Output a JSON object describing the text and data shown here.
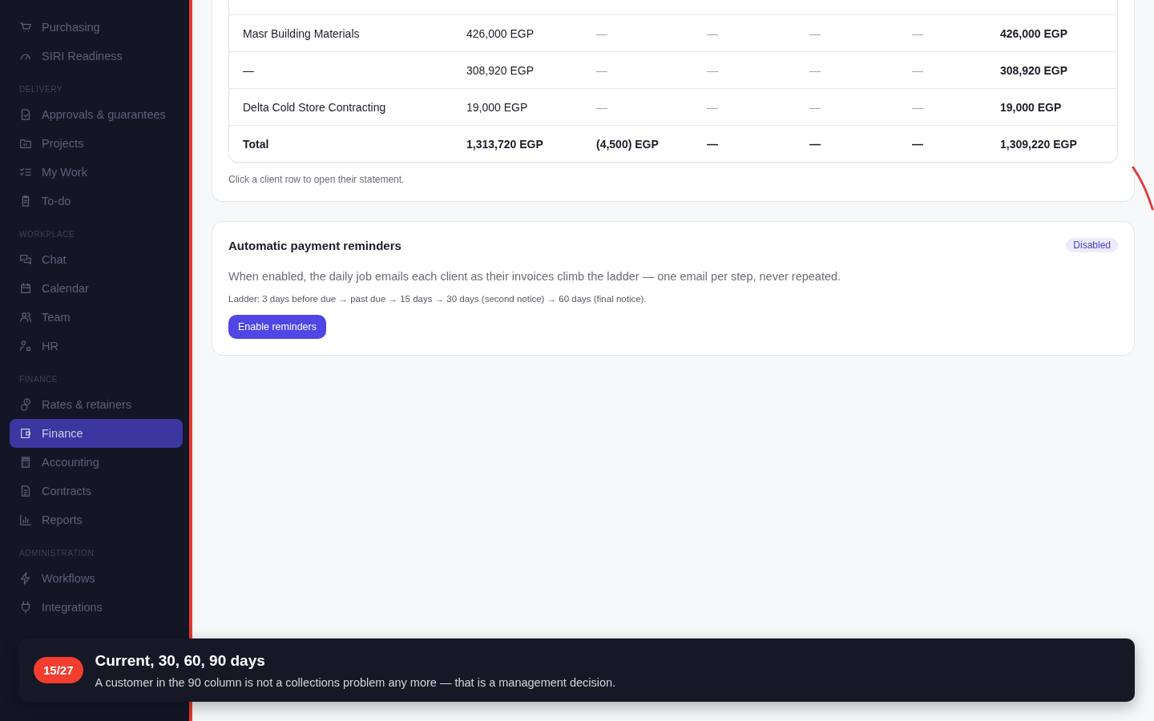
{
  "sidebar": {
    "sections": [
      {
        "items": [
          {
            "label": "Purchasing",
            "selected": false
          },
          {
            "label": "SIRI Readiness",
            "selected": false
          }
        ]
      },
      {
        "label": "DELIVERY",
        "items": [
          {
            "label": "Approvals & guarantees",
            "selected": false
          },
          {
            "label": "Projects",
            "selected": false
          },
          {
            "label": "My Work",
            "selected": false
          },
          {
            "label": "To-do",
            "selected": false
          }
        ]
      },
      {
        "label": "WORKPLACE",
        "items": [
          {
            "label": "Chat",
            "selected": false
          },
          {
            "label": "Calendar",
            "selected": false
          },
          {
            "label": "Team",
            "selected": false
          },
          {
            "label": "HR",
            "selected": false
          }
        ]
      },
      {
        "label": "FINANCE",
        "items": [
          {
            "label": "Rates & retainers",
            "selected": false
          },
          {
            "label": "Finance",
            "selected": true
          },
          {
            "label": "Accounting",
            "selected": false
          },
          {
            "label": "Contracts",
            "selected": false
          },
          {
            "label": "Reports",
            "selected": false
          }
        ]
      },
      {
        "label": "ADMINISTRATION",
        "items": [
          {
            "label": "Workflows",
            "selected": false
          },
          {
            "label": "Integrations",
            "selected": false
          }
        ]
      }
    ]
  },
  "aging_table": {
    "rows": [
      {
        "kind": "client",
        "cells": [
          {
            "text": "Masr Building Materials",
            "muted": false
          },
          {
            "text": "426,000 EGP",
            "muted": false
          },
          {
            "text": "—",
            "muted": true
          },
          {
            "text": "—",
            "muted": true
          },
          {
            "text": "—",
            "muted": true
          },
          {
            "text": "—",
            "muted": true
          },
          {
            "text": "426,000 EGP",
            "muted": false
          }
        ]
      },
      {
        "kind": "client",
        "cells": [
          {
            "text": "—",
            "muted": false
          },
          {
            "text": "308,920 EGP",
            "muted": false
          },
          {
            "text": "—",
            "muted": true
          },
          {
            "text": "—",
            "muted": true
          },
          {
            "text": "—",
            "muted": true
          },
          {
            "text": "—",
            "muted": true
          },
          {
            "text": "308,920 EGP",
            "muted": false
          }
        ]
      },
      {
        "kind": "client",
        "cells": [
          {
            "text": "Delta Cold Store Contracting",
            "muted": false
          },
          {
            "text": "19,000 EGP",
            "muted": false
          },
          {
            "text": "—",
            "muted": true
          },
          {
            "text": "—",
            "muted": true
          },
          {
            "text": "—",
            "muted": true
          },
          {
            "text": "—",
            "muted": true
          },
          {
            "text": "19,000 EGP",
            "muted": false
          }
        ]
      },
      {
        "kind": "total",
        "cells": [
          {
            "text": "Total",
            "muted": false
          },
          {
            "text": "1,313,720 EGP",
            "muted": false
          },
          {
            "text": "(4,500) EGP",
            "muted": false
          },
          {
            "text": "—",
            "muted": false
          },
          {
            "text": "—",
            "muted": false
          },
          {
            "text": "—",
            "muted": false
          },
          {
            "text": "1,309,220 EGP",
            "muted": false
          }
        ]
      }
    ],
    "note": "Click a client row to open their statement."
  },
  "reminders": {
    "title": "Automatic payment reminders",
    "status": "Disabled",
    "description": "When enabled, the daily job emails each client as their invoices climb the ladder — one email per step, never repeated.",
    "ladder": "Ladder: 3 days before due → past due → 15 days → 30 days (second notice) → 60 days (final notice).",
    "button": "Enable reminders"
  },
  "tour": {
    "step": "15/27",
    "title": "Current, 30, 60, 90 days",
    "text": "A customer in the 90 column is not a collections problem any more — that is a management decision."
  }
}
